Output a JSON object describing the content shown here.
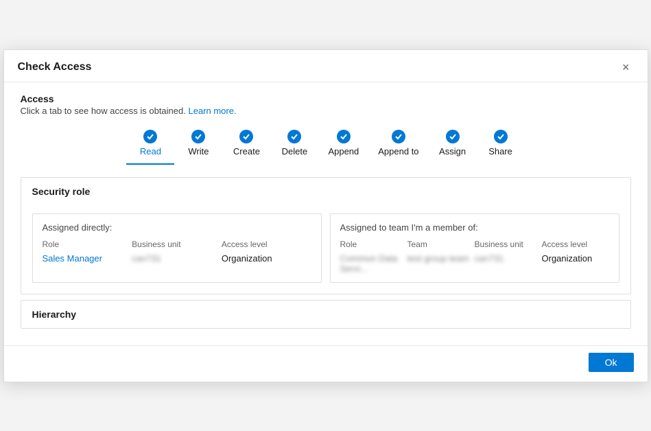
{
  "dialog": {
    "title": "Check Access",
    "close_label": "×"
  },
  "access_section": {
    "title": "Access",
    "subtitle": "Click a tab to see how access is obtained.",
    "learn_more": "Learn more."
  },
  "tabs": [
    {
      "id": "read",
      "label": "Read",
      "active": true
    },
    {
      "id": "write",
      "label": "Write",
      "active": false
    },
    {
      "id": "create",
      "label": "Create",
      "active": false
    },
    {
      "id": "delete",
      "label": "Delete",
      "active": false
    },
    {
      "id": "append",
      "label": "Append",
      "active": false
    },
    {
      "id": "append-to",
      "label": "Append to",
      "active": false
    },
    {
      "id": "assign",
      "label": "Assign",
      "active": false
    },
    {
      "id": "share",
      "label": "Share",
      "active": false
    }
  ],
  "security_role": {
    "section_title": "Security role",
    "assigned_directly": {
      "title": "Assigned directly:",
      "columns": [
        "Role",
        "Business unit",
        "Access level"
      ],
      "rows": [
        {
          "role_text": "Sales Manager",
          "role_link_part1": "Sales",
          "role_link_part2": "Manager",
          "business_unit": "can731",
          "access_level": "Organization"
        }
      ]
    },
    "assigned_team": {
      "title": "Assigned to team I'm a member of:",
      "columns": [
        "Role",
        "Team",
        "Business unit",
        "Access level"
      ],
      "rows": [
        {
          "role": "Common Data Servi...",
          "team": "test group team",
          "business_unit": "can731",
          "access_level": "Organization"
        }
      ]
    }
  },
  "hierarchy": {
    "section_title": "Hierarchy"
  },
  "footer": {
    "ok_label": "Ok"
  }
}
